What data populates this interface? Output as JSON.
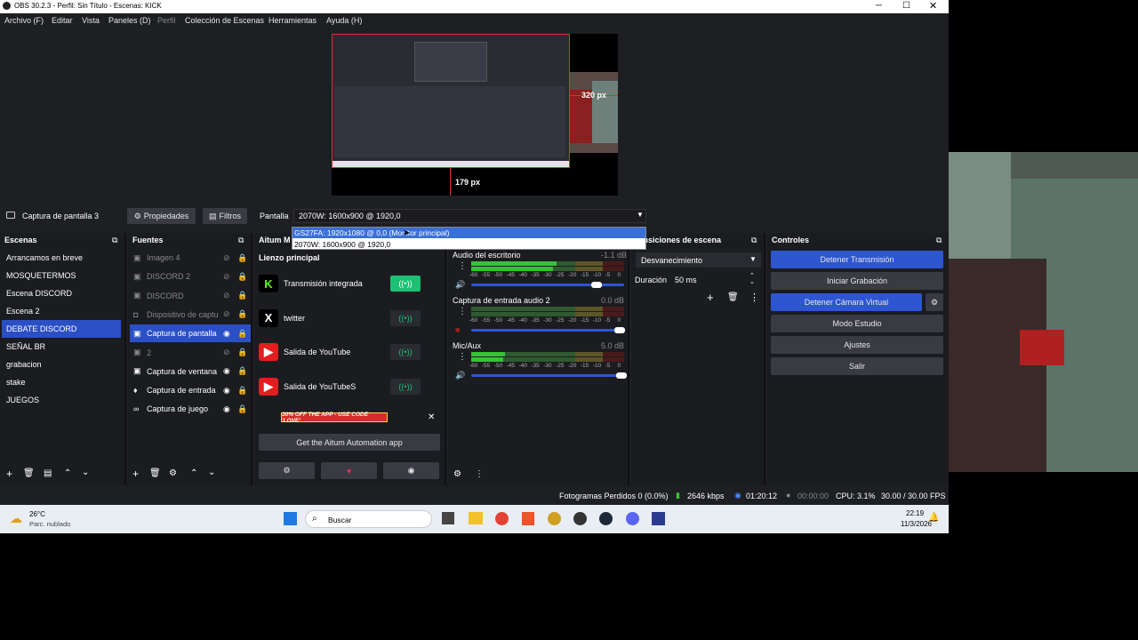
{
  "window": {
    "title": "OBS 30.2.3 - Perfil: Sin Título - Escenas: KICK"
  },
  "menu": [
    "Archivo (F)",
    "Editar",
    "Vista",
    "Paneles (D)",
    "Perfil",
    "Colección de Escenas",
    "Herramientas",
    "Ayuda (H)"
  ],
  "preview": {
    "right_measure": "320 px",
    "bottom_measure": "179 px"
  },
  "source_toolbar": {
    "source_name": "Captura de pantalla 3",
    "properties": "Propiedades",
    "filters": "Filtros",
    "display_label": "Pantalla",
    "display_value": "2070W: 1600x900 @ 1920,0"
  },
  "dropdown": {
    "options": [
      "GS27FA: 1920x1080 @ 0,0 (Monitor principal)",
      "2070W: 1600x900 @ 1920,0"
    ]
  },
  "scenes": {
    "title": "Escenas",
    "items": [
      "Arrancamos en breve",
      "MOSQUETERMOS",
      "Escena DISCORD",
      "Escena 2",
      "DEBATE DISCORD",
      "SEÑAL BR",
      "grabacion",
      "stake",
      "JUEGOS"
    ],
    "selected": 4
  },
  "sources": {
    "title": "Fuentes",
    "items": [
      "Imagen 4",
      "DISCORD 2",
      "DISCORD",
      "Dispositivo de captu",
      "Captura de pantalla",
      "2",
      "Captura de ventana",
      "Captura de entrada",
      "Captura de juego"
    ]
  },
  "aitum": {
    "title": "Aitum M",
    "canvas": "Lienzo principal",
    "outputs": [
      "Transmisión integrada",
      "twitter",
      "Salida de YouTube",
      "Salida de YouTubeS"
    ],
    "promo": "30% OFF THE APP - USE CODE 'LOVE'",
    "cta": "Get the Aitum Automation app"
  },
  "mixer": {
    "channels": [
      {
        "name": "Audio del escritorio",
        "db": "-1.1 dB"
      },
      {
        "name": "Captura de entrada audio 2",
        "db": "0.0 dB"
      },
      {
        "name": "Mic/Aux",
        "db": "5.0 dB"
      }
    ],
    "scale": [
      "-60",
      "-55",
      "-50",
      "-45",
      "-40",
      "-35",
      "-30",
      "-25",
      "-20",
      "-15",
      "-10",
      "-5",
      "0"
    ]
  },
  "transitions": {
    "title": "ransiciones de escena",
    "type": "Desvanecimiento",
    "duration_label": "Duración",
    "duration": "50 ms"
  },
  "controls": {
    "title": "Controles",
    "buttons": [
      "Detener Transmisión",
      "Iniciar Grabación",
      "Detener Cámara Virtual",
      "Modo Estudio",
      "Ajustes",
      "Salir"
    ]
  },
  "status": {
    "dropped": "Fotogramas Perdidos 0 (0.0%)",
    "kbps": "2646 kbps",
    "live_time": "01:20:12",
    "rec_time": "00:00:00",
    "cpu": "CPU: 3.1%",
    "fps": "30.00 / 30.00 FPS"
  },
  "taskbar": {
    "temp": "26°C",
    "weather": "Parc. nublado",
    "search": "Buscar",
    "time": "22:19",
    "date": "11/3/2026"
  },
  "colors": {
    "accent": "#2d56d0",
    "selected": "#2b4fc4",
    "meter_green": "#3bbf3b",
    "meter_yellow": "#b3a32c",
    "meter_red": "#8a1a1a"
  }
}
